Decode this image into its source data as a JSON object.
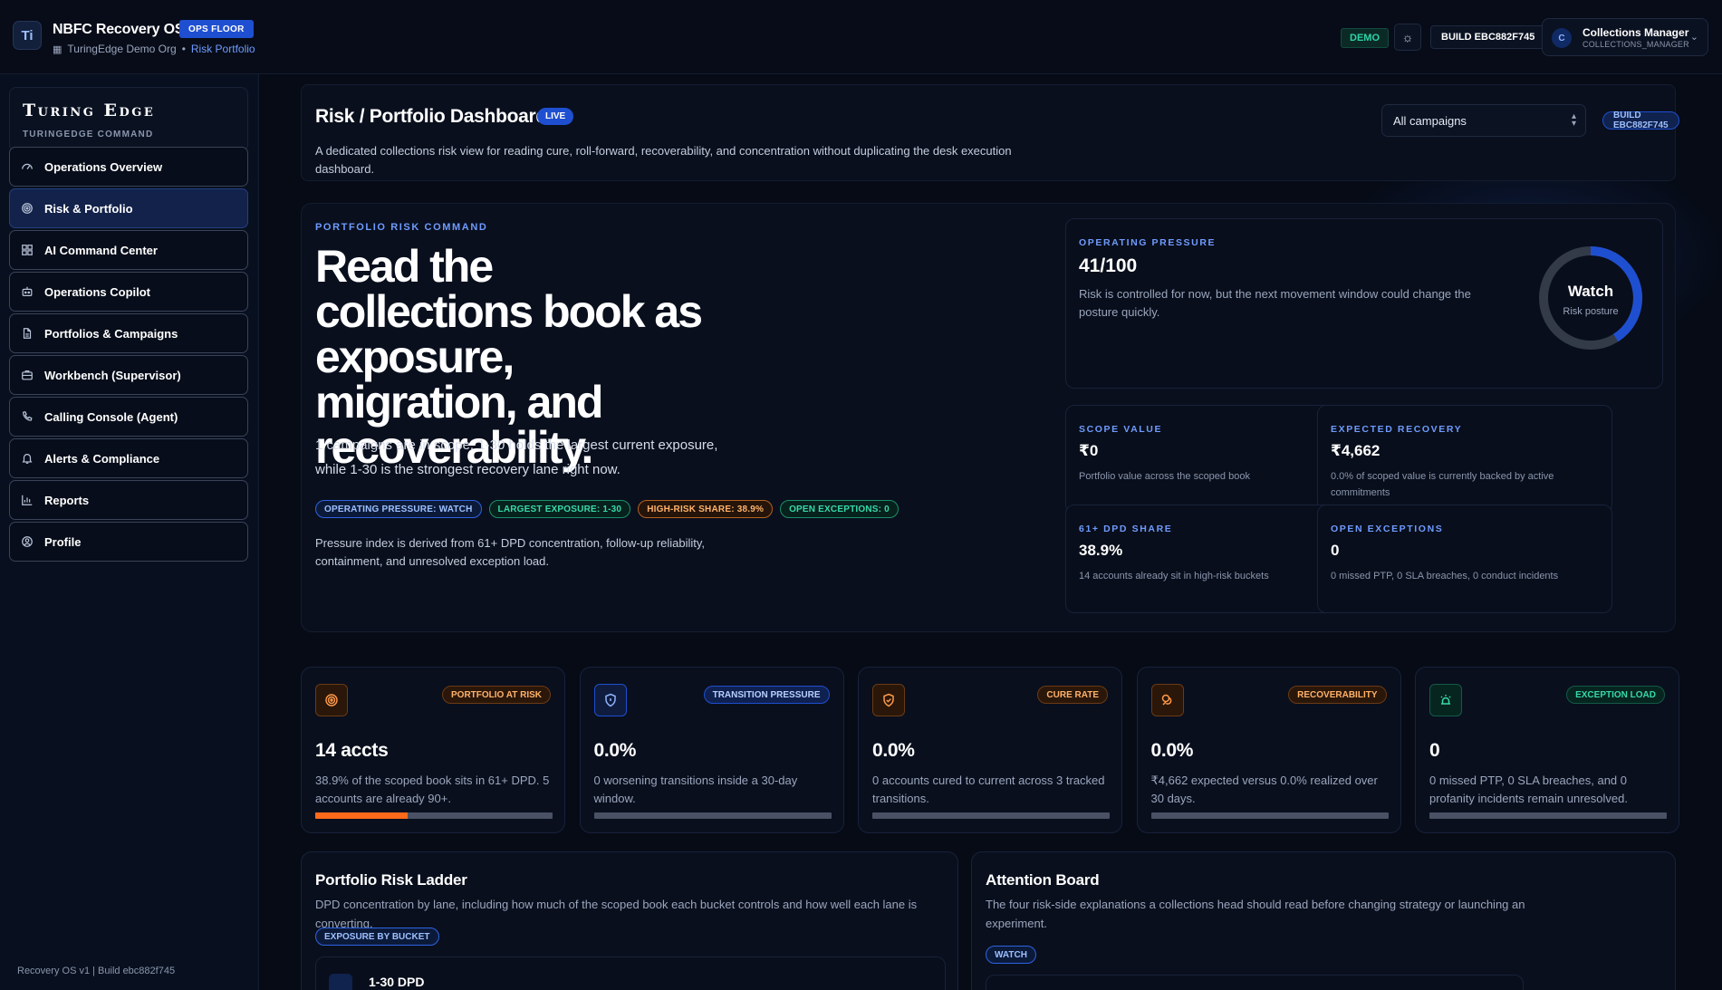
{
  "topbar": {
    "logo_glyph": "Ti",
    "app_title": "NBFC Recovery OS",
    "ops_badge": "OPS FLOOR",
    "org": "TuringEdge Demo Org",
    "separator": "•",
    "current": "Risk Portfolio",
    "demo": "DEMO",
    "build": "BUILD EBC882F745",
    "user": {
      "initial": "C",
      "name": "Collections Manager",
      "role": "COLLECTIONS_MANAGER"
    }
  },
  "sidebar": {
    "brand": "Turing Edge",
    "brand_sub": "TURINGEDGE COMMAND",
    "items": [
      {
        "label": "Operations Overview",
        "icon": "gauge-icon",
        "active": false
      },
      {
        "label": "Risk & Portfolio",
        "icon": "target-icon",
        "active": true
      },
      {
        "label": "AI Command Center",
        "icon": "grid-icon",
        "active": false
      },
      {
        "label": "Operations Copilot",
        "icon": "bot-icon",
        "active": false
      },
      {
        "label": "Portfolios & Campaigns",
        "icon": "file-icon",
        "active": false
      },
      {
        "label": "Workbench (Supervisor)",
        "icon": "briefcase-icon",
        "active": false
      },
      {
        "label": "Calling Console (Agent)",
        "icon": "phone-icon",
        "active": false
      },
      {
        "label": "Alerts & Compliance",
        "icon": "bell-icon",
        "active": false
      },
      {
        "label": "Reports",
        "icon": "bar-chart-icon",
        "active": false
      },
      {
        "label": "Profile",
        "icon": "user-icon",
        "active": false
      }
    ],
    "footer": "Recovery OS v1 | Build ebc882f745"
  },
  "header": {
    "title": "Risk / Portfolio Dashboard",
    "live": "LIVE",
    "description": "A dedicated collections risk view for reading cure, roll-forward, recoverability, and concentration without duplicating the desk execution dashboard.",
    "campaign_select": "All campaigns",
    "build": "BUILD EBC882F745"
  },
  "command": {
    "kicker": "PORTFOLIO RISK COMMAND",
    "headline": "Read the collections book as exposure, migration, and recoverability.",
    "summary": "1 campaigns are in scope. 1-30 holds the largest current exposure, while 1-30 is the strongest recovery lane right now.",
    "chips": [
      {
        "label": "OPERATING PRESSURE: WATCH",
        "tone": "blue"
      },
      {
        "label": "LARGEST EXPOSURE: 1-30",
        "tone": "green"
      },
      {
        "label": "HIGH-RISK SHARE: 38.9%",
        "tone": "orange"
      },
      {
        "label": "OPEN EXCEPTIONS: 0",
        "tone": "green"
      }
    ],
    "note": "Pressure index is derived from 61+ DPD concentration, follow-up reliability, containment, and unresolved exception load.",
    "pressure": {
      "kicker": "OPERATING PRESSURE",
      "value": "41/100",
      "score": 41,
      "description": "Risk is controlled for now, but the next movement window could change the posture quickly.",
      "gauge_label": "Watch",
      "gauge_sub": "Risk posture"
    },
    "stats": [
      {
        "kicker": "SCOPE VALUE",
        "value": "₹0",
        "description": "Portfolio value across the scoped book"
      },
      {
        "kicker": "EXPECTED RECOVERY",
        "value": "₹4,662",
        "description": "0.0% of scoped value is currently backed by active commitments"
      },
      {
        "kicker": "61+ DPD SHARE",
        "value": "38.9%",
        "description": "14 accounts already sit in high-risk buckets"
      },
      {
        "kicker": "OPEN EXCEPTIONS",
        "value": "0",
        "description": "0 missed PTP, 0 SLA breaches, 0 conduct incidents"
      }
    ]
  },
  "kpis": [
    {
      "badge": "PORTFOLIO AT RISK",
      "tone": "orange",
      "icon": "target-icon",
      "value": "14 accts",
      "description": "38.9% of the scoped book sits in 61+ DPD. 5 accounts are already 90+.",
      "progress": 0.389
    },
    {
      "badge": "TRANSITION PRESSURE",
      "tone": "blue",
      "icon": "shield-icon",
      "value": "0.0%",
      "description": "0 worsening transitions inside a 30-day window.",
      "progress": 0
    },
    {
      "badge": "CURE RATE",
      "tone": "orange",
      "icon": "shield-check-icon",
      "value": "0.0%",
      "description": "0 accounts cured to current across 3 tracked transitions.",
      "progress": 0
    },
    {
      "badge": "RECOVERABILITY",
      "tone": "orange",
      "icon": "coins-icon",
      "value": "0.0%",
      "description": "₹4,662 expected versus 0.0% realized over 30 days.",
      "progress": 0
    },
    {
      "badge": "EXCEPTION LOAD",
      "tone": "green",
      "icon": "siren-icon",
      "value": "0",
      "description": "0 missed PTP, 0 SLA breaches, and 0 profanity incidents remain unresolved.",
      "progress": 0
    }
  ],
  "ladder": {
    "title": "Portfolio Risk Ladder",
    "description": "DPD concentration by lane, including how much of the scoped book each bucket controls and how well each lane is converting.",
    "tag": "EXPOSURE BY BUCKET",
    "first_row": "1-30 DPD"
  },
  "attention": {
    "title": "Attention Board",
    "description": "The four risk-side explanations a collections head should read before changing strategy or launching an experiment.",
    "tag": "WATCH"
  },
  "colors": {
    "accent": "#1f4fd1",
    "orange": "#ff6a1a",
    "green": "#2fd3a6",
    "bg": "#060b16"
  }
}
